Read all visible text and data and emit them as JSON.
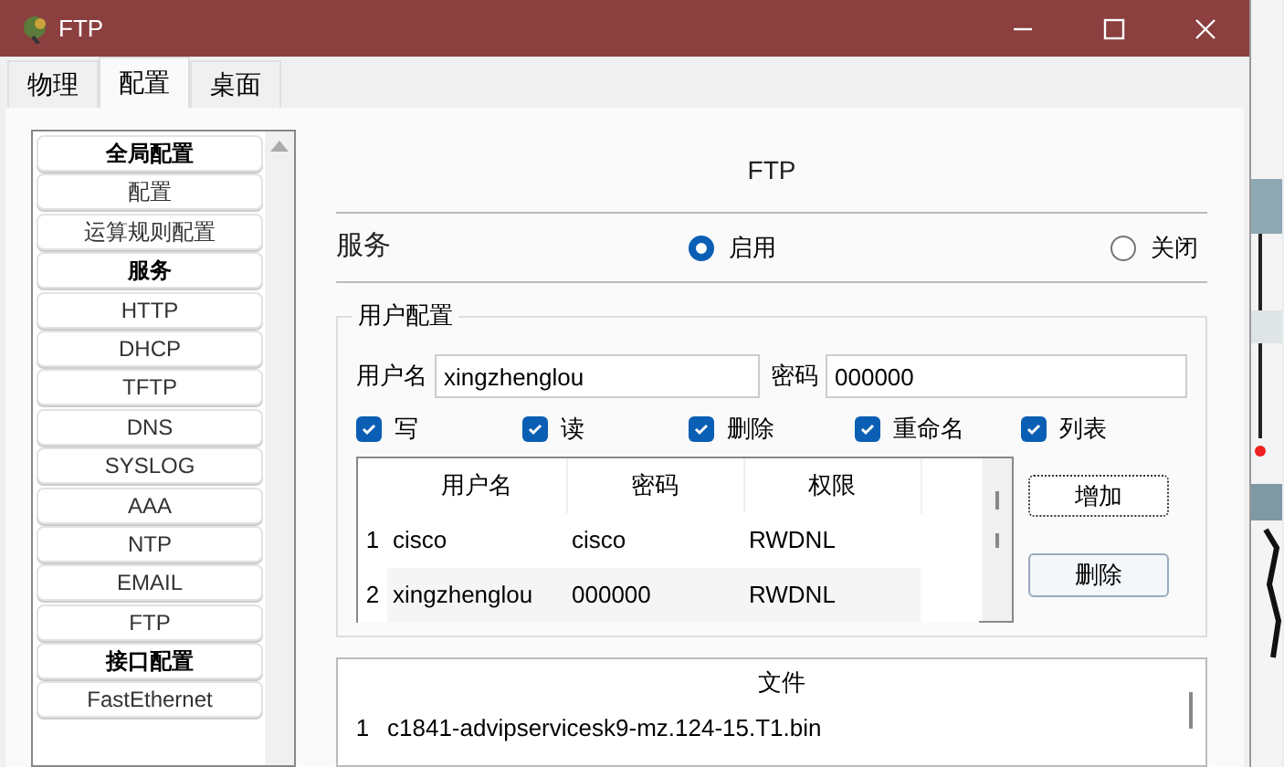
{
  "window": {
    "title": "FTP"
  },
  "tabs": [
    {
      "label": "物理",
      "selected": false
    },
    {
      "label": "配置",
      "selected": true
    },
    {
      "label": "桌面",
      "selected": false
    }
  ],
  "sidebar": {
    "items": [
      {
        "label": "全局配置",
        "kind": "header"
      },
      {
        "label": "配置",
        "kind": "item"
      },
      {
        "label": "运算规则配置",
        "kind": "item"
      },
      {
        "label": "服务",
        "kind": "header"
      },
      {
        "label": "HTTP",
        "kind": "item"
      },
      {
        "label": "DHCP",
        "kind": "item"
      },
      {
        "label": "TFTP",
        "kind": "item"
      },
      {
        "label": "DNS",
        "kind": "item"
      },
      {
        "label": "SYSLOG",
        "kind": "item"
      },
      {
        "label": "AAA",
        "kind": "item"
      },
      {
        "label": "NTP",
        "kind": "item"
      },
      {
        "label": "EMAIL",
        "kind": "item"
      },
      {
        "label": "FTP",
        "kind": "item"
      },
      {
        "label": "接口配置",
        "kind": "header"
      },
      {
        "label": "FastEthernet",
        "kind": "item"
      }
    ]
  },
  "panel": {
    "title": "FTP",
    "service": {
      "label": "服务",
      "options": [
        {
          "label": "启用",
          "selected": true
        },
        {
          "label": "关闭",
          "selected": false
        }
      ]
    },
    "user_config": {
      "title": "用户配置",
      "username_label": "用户名",
      "username": "xingzhenglou",
      "password_label": "密码",
      "password": "000000",
      "permissions": [
        {
          "label": "写",
          "checked": true
        },
        {
          "label": "读",
          "checked": true
        },
        {
          "label": "删除",
          "checked": true
        },
        {
          "label": "重命名",
          "checked": true
        },
        {
          "label": "列表",
          "checked": true
        }
      ],
      "table": {
        "columns": [
          "用户名",
          "密码",
          "权限"
        ],
        "rows": [
          {
            "index": "1",
            "cells": [
              "cisco",
              "cisco",
              "RWDNL"
            ]
          },
          {
            "index": "2",
            "cells": [
              "xingzhenglou",
              "000000",
              "RWDNL"
            ]
          }
        ]
      },
      "buttons": [
        "增加",
        "删除"
      ]
    },
    "files": {
      "columns": [
        "文件"
      ],
      "rows": [
        {
          "index": "1",
          "cells": [
            "c1841-advipservicesk9-mz.124-15.T1.bin"
          ]
        }
      ]
    }
  }
}
